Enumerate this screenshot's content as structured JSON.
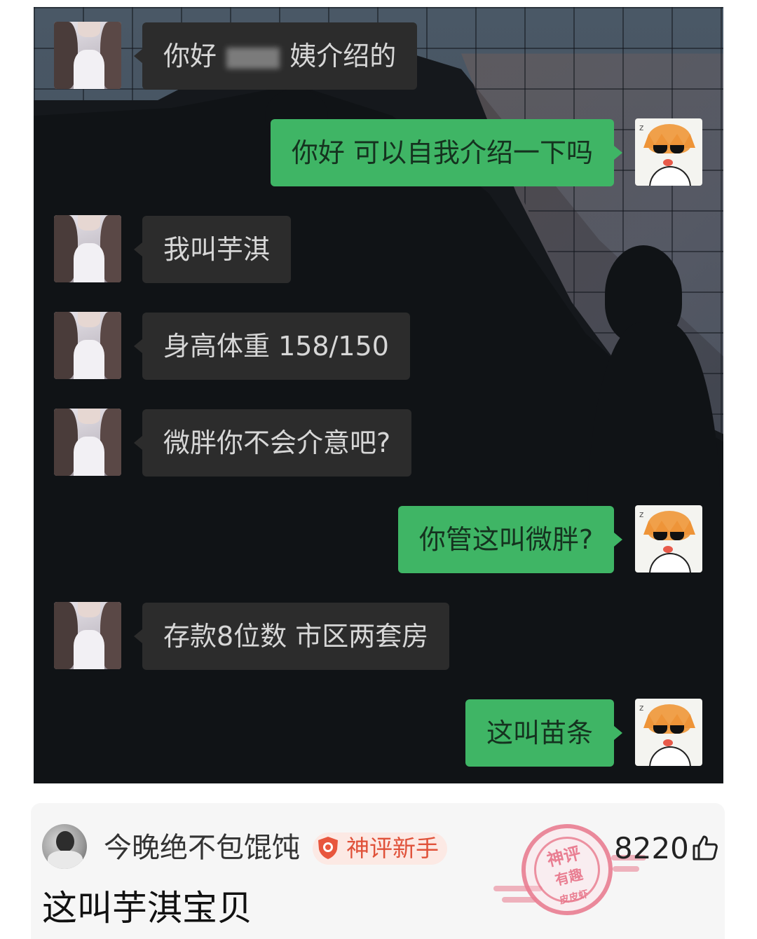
{
  "chat": {
    "messages": [
      {
        "side": "left",
        "text_before": "你好",
        "text_after": "姨介绍的"
      },
      {
        "side": "right",
        "text": "你好 可以自我介绍一下吗"
      },
      {
        "side": "left",
        "text": "我叫芋淇"
      },
      {
        "side": "left",
        "text": "身高体重 158/150"
      },
      {
        "side": "left",
        "text": "微胖你不会介意吧?"
      },
      {
        "side": "right",
        "text": "你管这叫微胖?"
      },
      {
        "side": "left",
        "text": "存款8位数 市区两套房"
      },
      {
        "side": "right",
        "text": "这叫苗条"
      }
    ],
    "colors": {
      "incoming_bubble": "#2c2c2c",
      "outgoing_bubble": "#3fb565"
    }
  },
  "comment": {
    "username": "今晚绝不包馄饨",
    "badge": "神评新手",
    "text": "这叫芋淇宝贝",
    "likes": "8220",
    "stamp": {
      "line1": "神评",
      "line2": "有趣",
      "line3": "皮皮虾"
    }
  }
}
